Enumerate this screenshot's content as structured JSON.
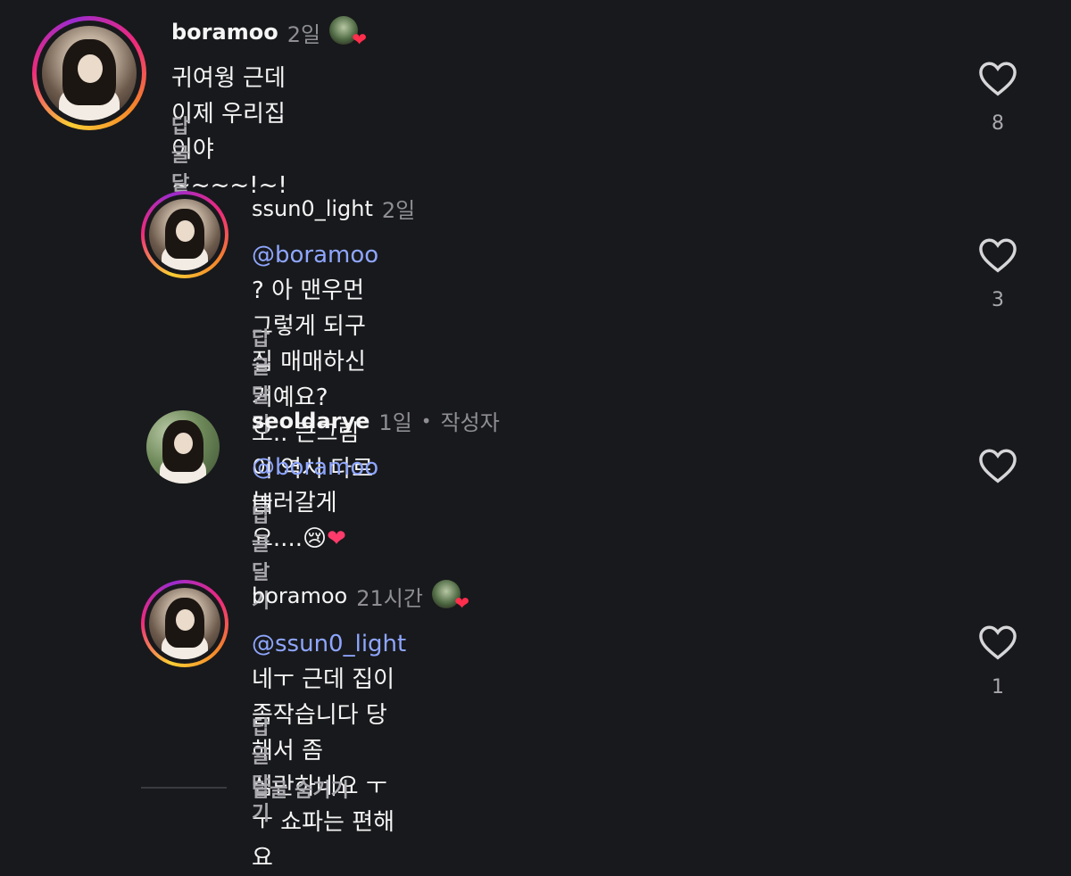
{
  "comments": [
    {
      "username": "boramoo",
      "time": "2일",
      "text": "귀여웡 근데 이제 우리집이야~~~~!~!",
      "reply": "답글 달기",
      "likes": "8"
    },
    {
      "username": "ssun0_light",
      "time": "2일",
      "mention": "@boramoo",
      "text_line1": " ? 아 맨우먼 그렇게 되구 집 매매하신거예요?",
      "text_line2": "오.. 큰그림이 역시 다르네",
      "reply": "답글 달기",
      "likes": "3"
    },
    {
      "username": "seoldarye",
      "time": "1일",
      "dot": "•",
      "author_label": "작성자",
      "mention": "@boramoo",
      "text": " 놀러갈게요....",
      "emoji1": "😢",
      "emoji2": "❤",
      "reply": "답글 달기"
    },
    {
      "username": "boramoo",
      "time": "21시간",
      "mention": "@ssun0_light",
      "text_line1": " 네ㅜ 근데 집이좀작습니다 당해서 좀",
      "text_line2": "심란하네요 ㅜㅜ 쇼파는 편해요",
      "reply": "답글 달기",
      "likes": "1"
    }
  ],
  "hide_replies": "답글 숨기기",
  "colors": {
    "background": "#18191c",
    "mention": "#8ea6ff",
    "muted": "#8e8e93",
    "heart_outline": "#d6d6d9"
  },
  "icons": [
    "heart-outline-icon",
    "heart-red-icon",
    "crying-face-emoji"
  ]
}
